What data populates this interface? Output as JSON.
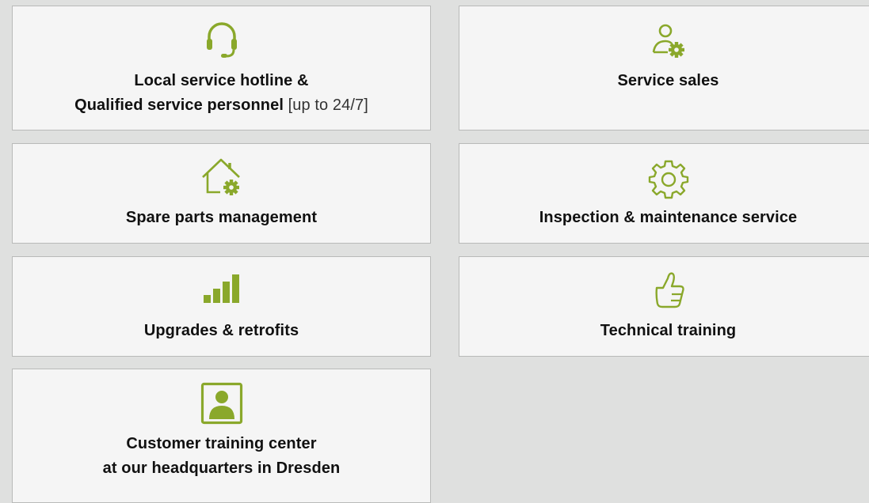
{
  "accent": "#8aa82b",
  "tiles": {
    "hotline": {
      "icon": "headset-icon",
      "line1": "Local service hotline &",
      "line2": "Qualified service personnel",
      "note": " [up to 24/7]"
    },
    "sales": {
      "icon": "user-gear-icon",
      "line1": "Service sales"
    },
    "spare": {
      "icon": "house-gear-icon",
      "line1": "Spare parts management"
    },
    "inspection": {
      "icon": "gear-icon",
      "line1": "Inspection & maintenance service"
    },
    "upgrades": {
      "icon": "signal-bars-icon",
      "line1": "Upgrades & retrofits"
    },
    "training": {
      "icon": "thumbs-up-icon",
      "line1": "Technical training"
    },
    "center": {
      "icon": "user-portrait-icon",
      "line1": "Customer training center",
      "line2": "at our headquarters in Dresden"
    }
  }
}
